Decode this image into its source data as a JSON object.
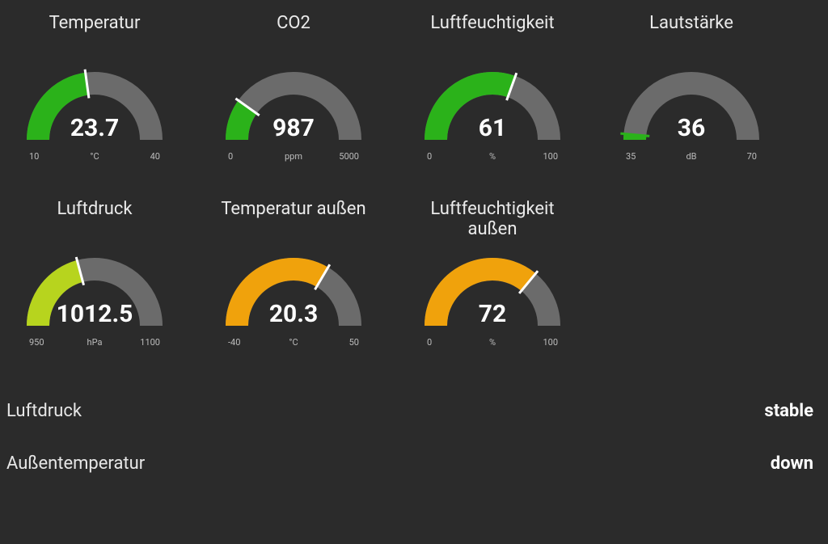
{
  "chart_data": [
    {
      "id": "temperatur",
      "type": "gauge",
      "title": "Temperatur",
      "value": 23.7,
      "display": "23.7",
      "min": 10,
      "max": 40,
      "unit": "°C",
      "color": "#2bb21a",
      "needleColor": "#ffffff"
    },
    {
      "id": "co2",
      "type": "gauge",
      "title": "CO2",
      "value": 987,
      "display": "987",
      "min": 0,
      "max": 5000,
      "unit": "ppm",
      "color": "#2bb21a",
      "needleColor": "#ffffff"
    },
    {
      "id": "luftfeuchtigkeit",
      "type": "gauge",
      "title": "Luftfeuchtigkeit",
      "value": 61,
      "display": "61",
      "min": 0,
      "max": 100,
      "unit": "%",
      "color": "#2bb21a",
      "needleColor": "#ffffff"
    },
    {
      "id": "lautstaerke",
      "type": "gauge",
      "title": "Lautstärke",
      "value": 36,
      "display": "36",
      "min": 35,
      "max": 70,
      "unit": "dB",
      "color": "#2bb21a",
      "needleColor": "#2bb21a"
    },
    {
      "id": "luftdruck",
      "type": "gauge",
      "title": "Luftdruck",
      "value": 1012.5,
      "display": "1012.5",
      "min": 950,
      "max": 1100,
      "unit": "hPa",
      "color": "#b7d41e",
      "needleColor": "#ffffff"
    },
    {
      "id": "temp_aussen",
      "type": "gauge",
      "title": "Temperatur außen",
      "value": 20.3,
      "display": "20.3",
      "min": -40,
      "max": 50,
      "unit": "°C",
      "color": "#f0a20c",
      "needleColor": "#ffffff"
    },
    {
      "id": "luftfeuchtigkeit_aussen",
      "type": "gauge",
      "title": "Luftfeuchtigkeit außen",
      "value": 72,
      "display": "72",
      "min": 0,
      "max": 100,
      "unit": "%",
      "color": "#f0a20c",
      "needleColor": "#ffffff"
    }
  ],
  "status": [
    {
      "label": "Luftdruck",
      "value": "stable"
    },
    {
      "label": "Außentemperatur",
      "value": "down"
    }
  ],
  "layout": {
    "row1": [
      "temperatur",
      "co2",
      "luftfeuchtigkeit",
      "lautstaerke"
    ],
    "row2": [
      "luftdruck",
      "temp_aussen",
      "luftfeuchtigkeit_aussen"
    ]
  }
}
